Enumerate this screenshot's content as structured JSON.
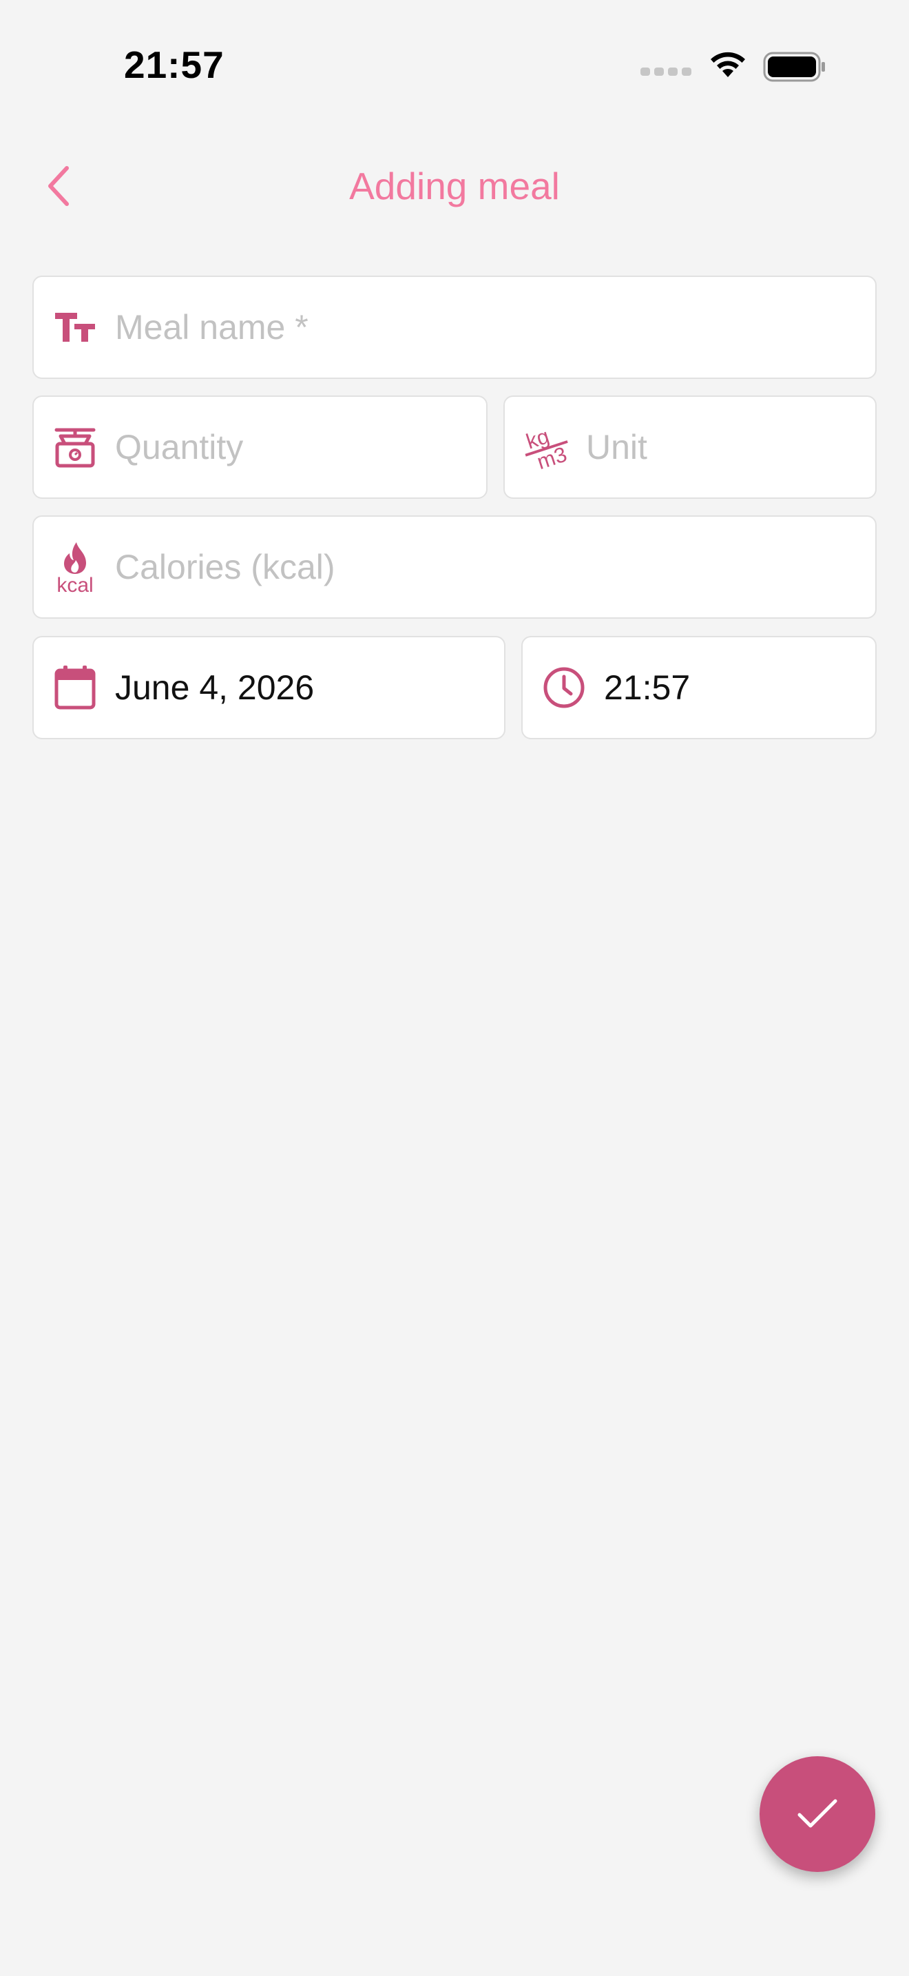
{
  "status_bar": {
    "time": "21:57"
  },
  "nav": {
    "title": "Adding meal",
    "back_icon": "chevron-left-icon"
  },
  "form": {
    "meal_name": {
      "placeholder": "Meal name *",
      "value": "",
      "icon": "text-size-icon"
    },
    "quantity": {
      "placeholder": "Quantity",
      "value": "",
      "icon": "scale-icon"
    },
    "unit": {
      "placeholder": "Unit",
      "value": "",
      "icon": "kg-m3-unit-icon",
      "icon_text_top": "kg",
      "icon_text_bottom": "m3"
    },
    "calories": {
      "placeholder": "Calories (kcal)",
      "value": "",
      "icon": "flame-kcal-icon",
      "icon_text": "kcal"
    },
    "date": {
      "value": "June 4, 2026",
      "icon": "calendar-icon"
    },
    "time": {
      "value": "21:57",
      "icon": "clock-icon"
    }
  },
  "fab": {
    "icon": "checkmark-icon"
  },
  "colors": {
    "accent": "#c84f7b",
    "title": "#f2799f",
    "background": "#f4f4f4",
    "placeholder": "#c2c2c2"
  }
}
